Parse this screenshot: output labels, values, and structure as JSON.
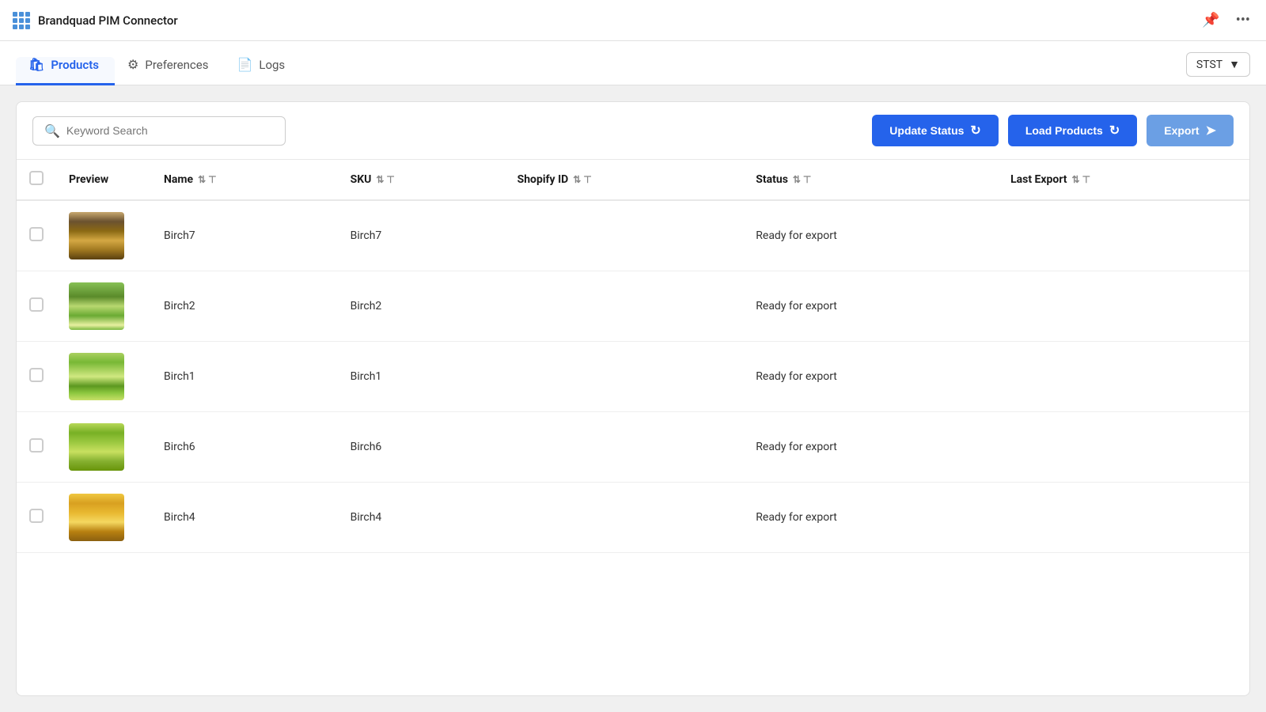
{
  "app": {
    "title": "Brandquad PIM Connector"
  },
  "nav": {
    "tabs": [
      {
        "id": "products",
        "label": "Products",
        "icon": "🛍",
        "active": true
      },
      {
        "id": "preferences",
        "label": "Preferences",
        "icon": "⚙",
        "active": false
      },
      {
        "id": "logs",
        "label": "Logs",
        "icon": "📄",
        "active": false
      }
    ],
    "store_selector": "STST"
  },
  "toolbar": {
    "search_placeholder": "Keyword Search",
    "update_status_label": "Update Status",
    "load_products_label": "Load Products",
    "export_label": "Export"
  },
  "table": {
    "columns": [
      {
        "id": "checkbox",
        "label": ""
      },
      {
        "id": "preview",
        "label": "Preview"
      },
      {
        "id": "name",
        "label": "Name",
        "sortable": true,
        "filterable": true
      },
      {
        "id": "sku",
        "label": "SKU",
        "sortable": true,
        "filterable": true
      },
      {
        "id": "shopify_id",
        "label": "Shopify ID",
        "sortable": true,
        "filterable": true
      },
      {
        "id": "status",
        "label": "Status",
        "sortable": true,
        "filterable": true
      },
      {
        "id": "last_export",
        "label": "Last Export",
        "sortable": true,
        "filterable": true
      }
    ],
    "rows": [
      {
        "id": 1,
        "name": "Birch7",
        "sku": "Birch7",
        "shopify_id": "",
        "status": "Ready for export",
        "last_export": "",
        "thumb_class": "thumb-birch7"
      },
      {
        "id": 2,
        "name": "Birch2",
        "sku": "Birch2",
        "shopify_id": "",
        "status": "Ready for export",
        "last_export": "",
        "thumb_class": "thumb-birch2"
      },
      {
        "id": 3,
        "name": "Birch1",
        "sku": "Birch1",
        "shopify_id": "",
        "status": "Ready for export",
        "last_export": "",
        "thumb_class": "thumb-birch1"
      },
      {
        "id": 4,
        "name": "Birch6",
        "sku": "Birch6",
        "shopify_id": "",
        "status": "Ready for export",
        "last_export": "",
        "thumb_class": "thumb-birch6"
      },
      {
        "id": 5,
        "name": "Birch4",
        "sku": "Birch4",
        "shopify_id": "",
        "status": "Ready for export",
        "last_export": "",
        "thumb_class": "thumb-birch4"
      }
    ]
  }
}
